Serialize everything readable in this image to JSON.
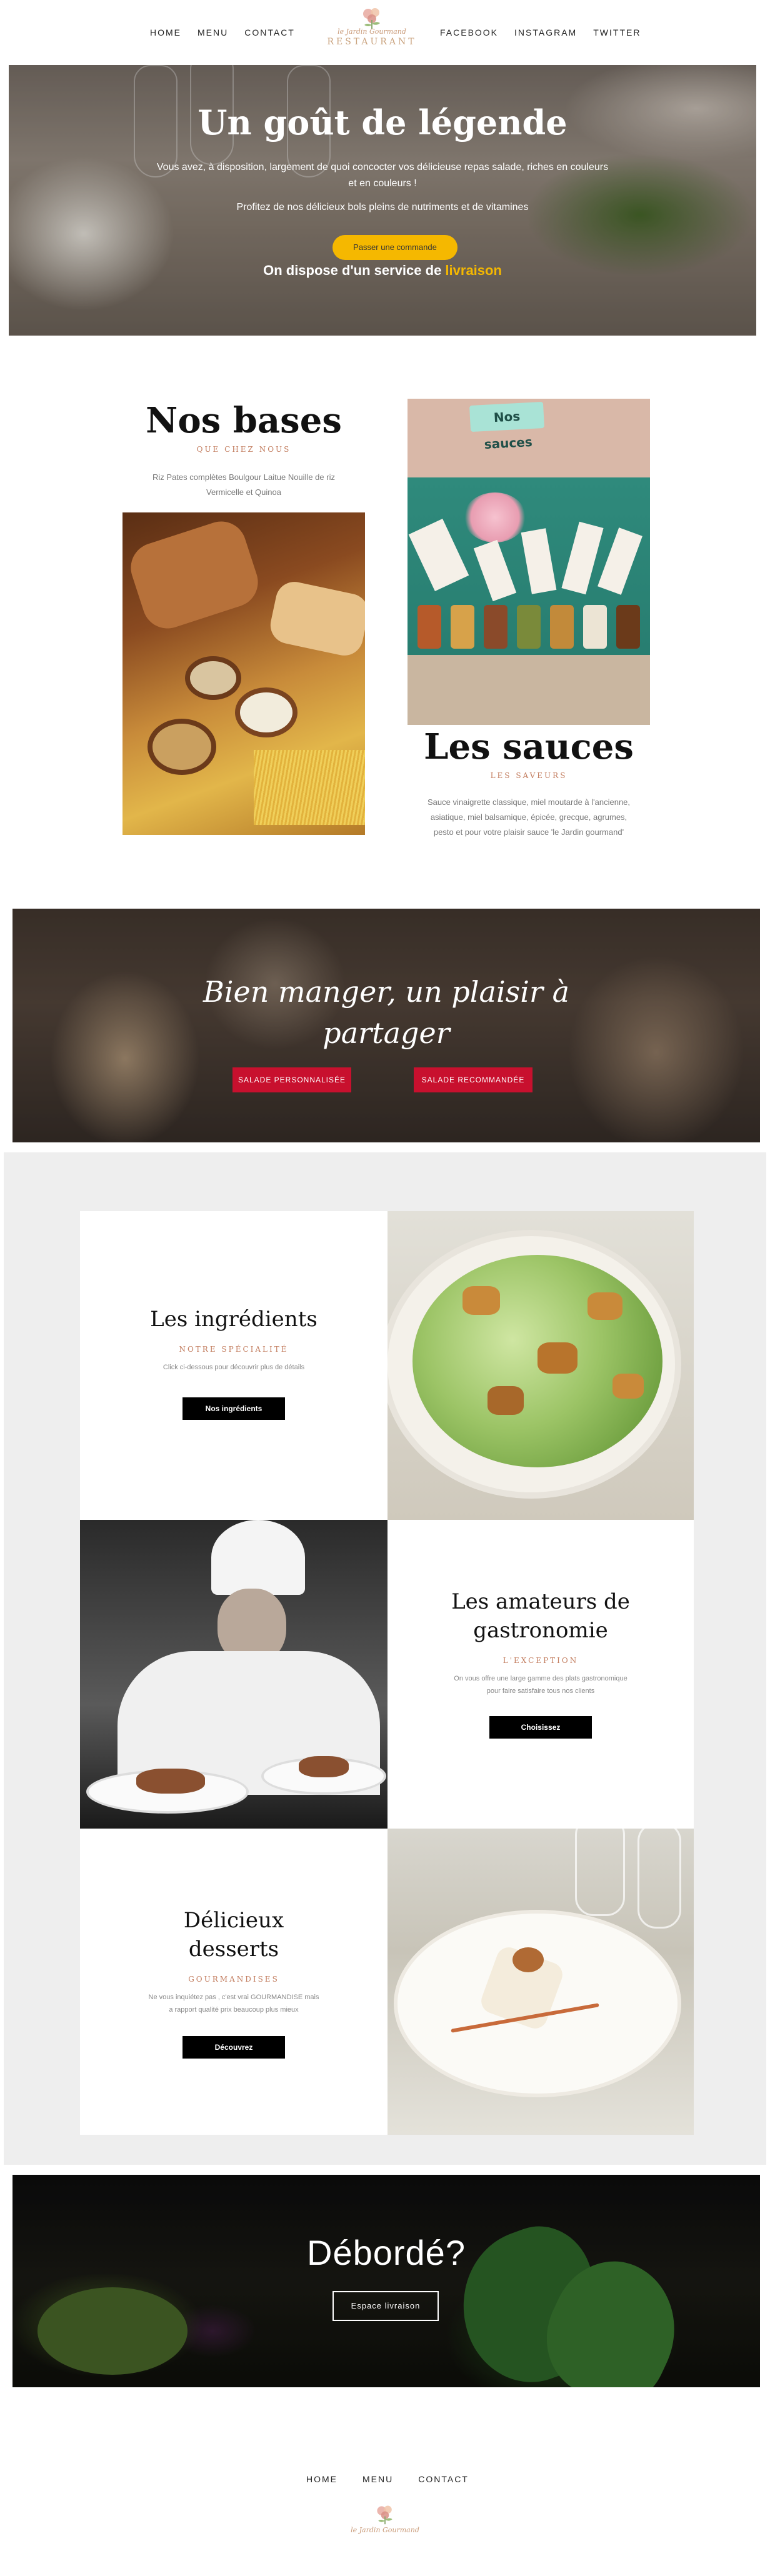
{
  "header": {
    "nav_left": [
      "HOME",
      "MENU",
      "CONTACT"
    ],
    "nav_right": [
      "FACEBOOK",
      "INSTAGRAM",
      "TWITTER"
    ],
    "logo_script": "le Jardin Gourmand",
    "logo_word": "RESTAURANT"
  },
  "hero": {
    "title": "Un goût de légende",
    "text_line1": "Vous avez, à disposition, largement de quoi concocter vos délicieuse repas salade, riches en couleurs",
    "text_line2": "et en couleurs !",
    "text_line3": "Profitez de nos délicieux bols pleins de nutriments et de vitamines",
    "button": "Passer une commande",
    "delivery_prefix": "On dispose d'un service de ",
    "delivery_highlight": "livraison"
  },
  "bases": {
    "title": "Nos bases",
    "subtitle": "QUE CHEZ NOUS",
    "desc_line1": "Riz Pates complètes Boulgour Laitue Nouille de riz",
    "desc_line2": "Vermicelle et Quinoa"
  },
  "sauces": {
    "sign": "Nos sauces",
    "title": "Les sauces",
    "subtitle": "LES SAVEURS",
    "desc_line1": "Sauce vinaigrette classique, miel moutarde à l'ancienne,",
    "desc_line2": "asiatique, miel balsamique, épicée, grecque, agrumes,",
    "desc_line3": "pesto et pour votre plaisir sauce 'le Jardin gourmand'"
  },
  "banner": {
    "title_line1": "Bien manger, un plaisir à",
    "title_line2": "partager",
    "button_left": "SALADE PERSONNALISÉE",
    "button_right": "SALADE RECOMMANDÉE"
  },
  "cards": {
    "ingredients": {
      "title": "Les ingrédients",
      "subtitle": "NOTRE SPÉCIALITÉ",
      "desc": "Click ci-dessous pour découvrir plus de détails",
      "button": "Nos ingrédients"
    },
    "gastronomie": {
      "title_line1": "Les amateurs de",
      "title_line2": "gastronomie",
      "subtitle": "L'EXCEPTION",
      "desc_line1": "On vous offre une large gamme des plats gastronomique",
      "desc_line2": "pour faire satisfaire tous nos clients",
      "button": "Choisissez"
    },
    "desserts": {
      "title_line1": "Délicieux",
      "title_line2": "desserts",
      "subtitle": "GOURMANDISES",
      "desc_line1": "Ne vous inquiétez pas , c'est vrai GOURMANDISE mais",
      "desc_line2": "a rapport qualité prix beaucoup plus mieux",
      "button": "Découvrez"
    }
  },
  "deborde": {
    "title": "Débordé?",
    "button": "Espace livraison"
  },
  "footer": {
    "nav": [
      "HOME",
      "MENU",
      "CONTACT"
    ],
    "logo_script": "le Jardin Gourmand"
  },
  "colors": {
    "accent_gold": "#f5b800",
    "accent_red": "#c8102e",
    "subtitle_copper": "#c27c5e",
    "grey_bg": "#eeeeee"
  }
}
